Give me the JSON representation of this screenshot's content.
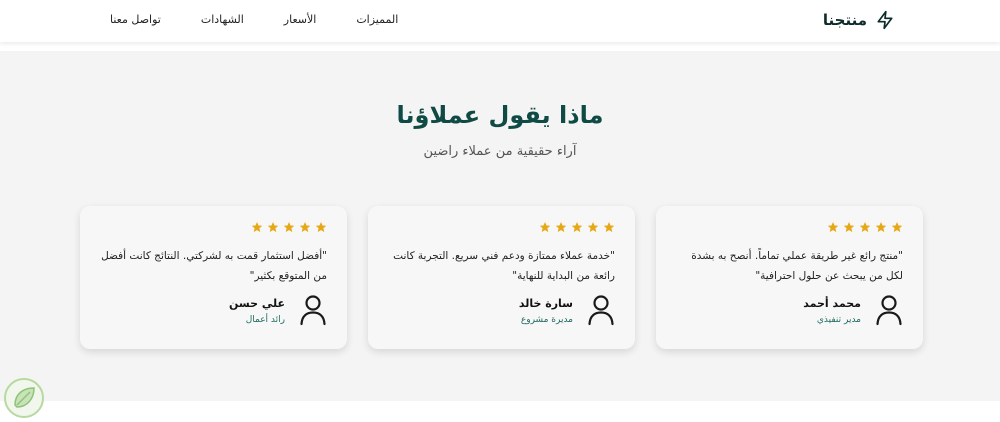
{
  "brand": {
    "name": "منتجنا",
    "icon": "lightning-icon"
  },
  "nav": {
    "items": [
      {
        "label": "المميزات"
      },
      {
        "label": "الأسعار"
      },
      {
        "label": "الشهادات"
      },
      {
        "label": "تواصل معنا"
      }
    ]
  },
  "section": {
    "title": "ماذا يقول عملاؤنا",
    "subtitle": "آراء حقيقية من عملاء راضين"
  },
  "testimonials": [
    {
      "rating": 5,
      "quote": "\"منتج رائع غير طريقة عملي تماماً. أنصح به بشدة لكل من يبحث عن حلول احترافية\"",
      "name": "محمد أحمد",
      "role": "مدير تنفيذي"
    },
    {
      "rating": 5,
      "quote": "\"خدمة عملاء ممتازة ودعم فني سريع. التجربة كانت رائعة من البداية للنهاية\"",
      "name": "سارة خالد",
      "role": "مديرة مشروع"
    },
    {
      "rating": 5,
      "quote": "\"أفضل استثمار قمت به لشركتي. النتائج كانت أفضل من المتوقع بكثير\"",
      "name": "علي حسن",
      "role": "رائد أعمال"
    }
  ],
  "colors": {
    "accent": "#0f4a45",
    "star": "#e6a817",
    "role": "#1d6b5f",
    "section_bg": "#f4f4f4"
  }
}
